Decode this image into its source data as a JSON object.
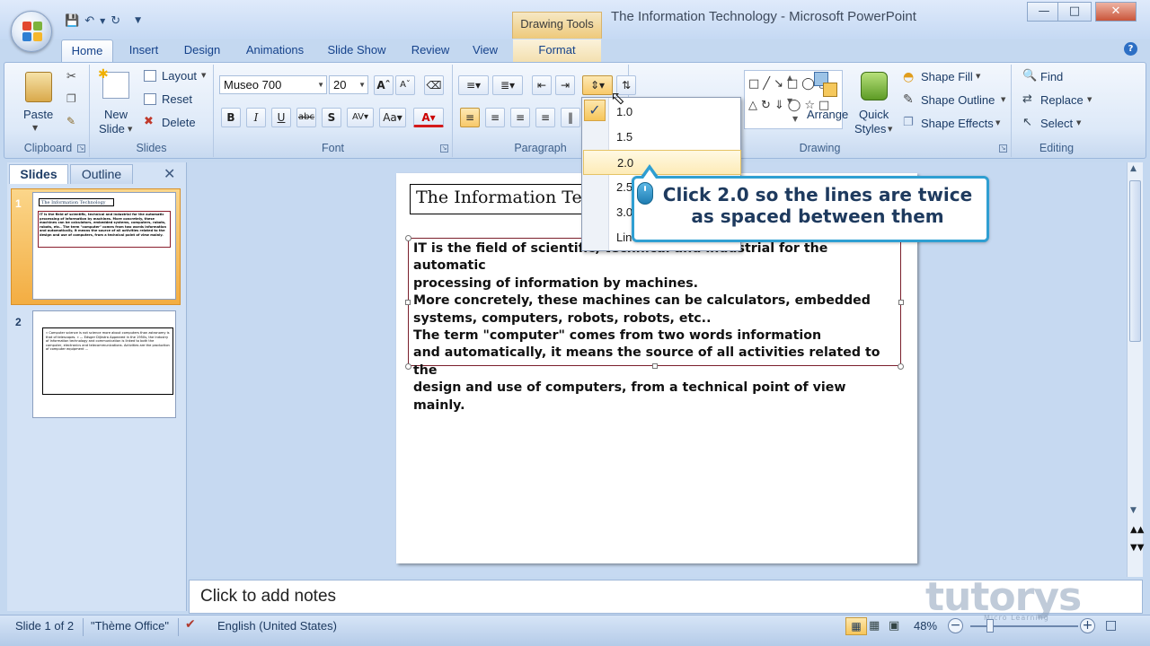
{
  "window": {
    "title": "The Information Technology - Microsoft PowerPoint",
    "contextual_tab_group": "Drawing Tools",
    "minimize": "—",
    "maximize": "□",
    "close": "✕"
  },
  "ribbon_tabs": [
    "Home",
    "Insert",
    "Design",
    "Animations",
    "Slide Show",
    "Review",
    "View",
    "Format"
  ],
  "clipboard": {
    "paste": "Paste",
    "label": "Clipboard"
  },
  "slides_group": {
    "new_slide_1": "New",
    "new_slide_2": "Slide",
    "layout": "Layout",
    "reset": "Reset",
    "delete": "Delete",
    "label": "Slides"
  },
  "font": {
    "family": "Museo 700",
    "size": "20",
    "label": "Font"
  },
  "paragraph": {
    "label": "Paragraph"
  },
  "drawing": {
    "arrange": "Arrange",
    "quick_styles_1": "Quick",
    "quick_styles_2": "Styles",
    "shape_fill": "Shape Fill",
    "shape_outline": "Shape Outline",
    "shape_effects": "Shape Effects",
    "label": "Drawing"
  },
  "editing": {
    "find": "Find",
    "replace": "Replace",
    "select": "Select",
    "label": "Editing"
  },
  "line_spacing_menu": {
    "items": [
      "1.0",
      "1.5",
      "2.0",
      "2.5",
      "3.0",
      "Line"
    ],
    "selected": "1.0",
    "hovered": "2.0"
  },
  "left_panel": {
    "tabs": [
      "Slides",
      "Outline"
    ],
    "slide_numbers": [
      "1",
      "2"
    ],
    "thumb1_title": "The Information Technology",
    "thumb1_body": "IT is the field of scientific, technical and industrial for the automatic processing of information by machines. More concretely, these machines can be calculators, embedded systems, computers, robots, robots, etc.. The term \"computer\" comes from two words information and automatically, it means the source of all activities related to the design and use of computers, from a technical point of view mainly.",
    "thumb2_body": "« Computer science is not science more about computers than astronomy is that of telescopes. » — Edsger Dijkstra Appeared in the 1950s, the Industry of Information technology and communication is linked to both the computer, electronics and telecommunications. Activities are the production of computer equipment …"
  },
  "slide": {
    "title": "The Information Technology",
    "body_lines": [
      "IT is the field of scientific, technical and industrial for the automatic",
      "processing of information by machines.",
      "More concretely, these machines can be calculators, embedded",
      "systems, computers, robots, robots, etc..",
      "The term \"computer\" comes from two words information",
      "and automatically, it means the source of all activities related to the",
      "design and use of computers, from a technical point of view mainly."
    ]
  },
  "callout": {
    "text": "Click 2.0 so the lines are twice as spaced between them"
  },
  "notes": {
    "placeholder": "Click to add notes"
  },
  "status_bar": {
    "slide_count": "Slide 1 of 2",
    "theme": "\"Thème Office\"",
    "language": "English (United States)",
    "zoom": "48%"
  },
  "watermark": {
    "brand": "tutorys",
    "tagline": "Micro Learning"
  },
  "colors": {
    "accent": "#2f9fd2",
    "ribbon": "#dde9f8",
    "text_box_border": "#7b1f2c",
    "slide_selected": "#f3ad42"
  }
}
